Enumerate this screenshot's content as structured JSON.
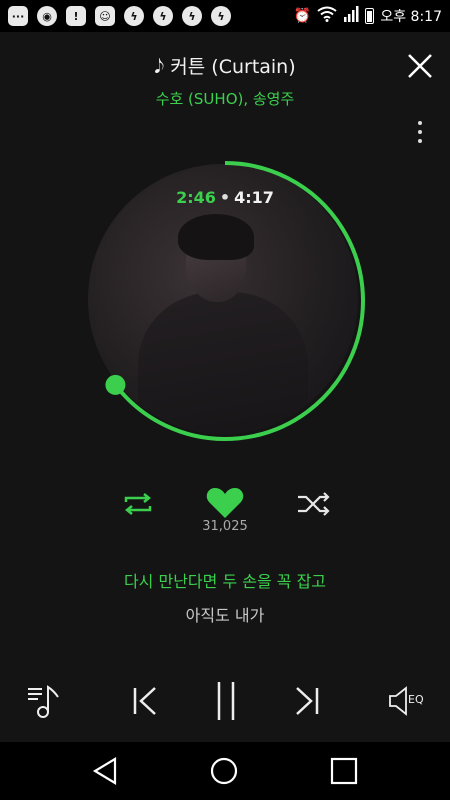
{
  "status_bar": {
    "time": "오후 8:17",
    "notification_icons": [
      "chat-icon",
      "camera-icon",
      "alert-icon",
      "gift-icon",
      "messenger-icon",
      "messenger-icon",
      "messenger-icon",
      "messenger-icon"
    ]
  },
  "player": {
    "title": "커튼 (Curtain)",
    "artist": "수호 (SUHO), 송영주",
    "time_current": "2:46",
    "time_total": "4:17",
    "progress_fraction": 0.646,
    "like_count": "31,025",
    "liked": true,
    "accent_color": "#3ccf4e"
  },
  "lyrics": {
    "current": "다시 만난다면 두 손을 꼭 잡고",
    "next": "아직도 내가"
  },
  "controls": {
    "eq_label": "EQ"
  }
}
